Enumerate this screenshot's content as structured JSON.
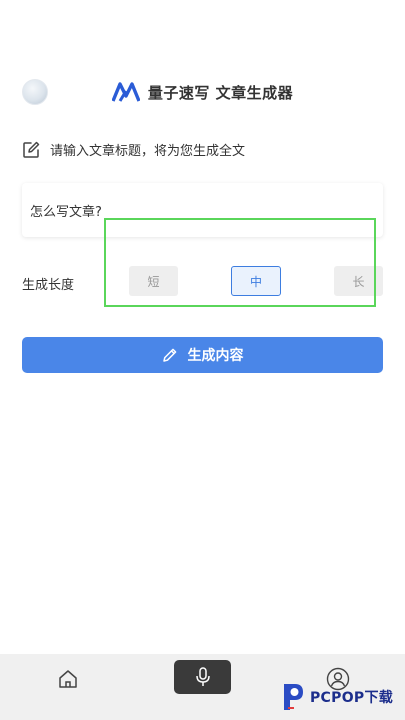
{
  "header": {
    "title": "量子速写 文章生成器"
  },
  "prompt": {
    "text": "请输入文章标题，将为您生成全文"
  },
  "input": {
    "value": "怎么写文章?"
  },
  "length": {
    "label": "生成长度",
    "options": [
      "短",
      "中",
      "长"
    ],
    "selected": "中"
  },
  "generate": {
    "label": "生成内容"
  },
  "nav": {
    "items": [
      "home-icon",
      "microphone-icon",
      "user-icon"
    ],
    "active": "microphone-icon"
  },
  "watermark": {
    "text": "PCPOP下载"
  },
  "colors": {
    "accent": "#4a86e8",
    "selected_border": "#3d7de0",
    "highlight": "#5ad65a",
    "nav_active_bg": "#3a3a3a"
  }
}
